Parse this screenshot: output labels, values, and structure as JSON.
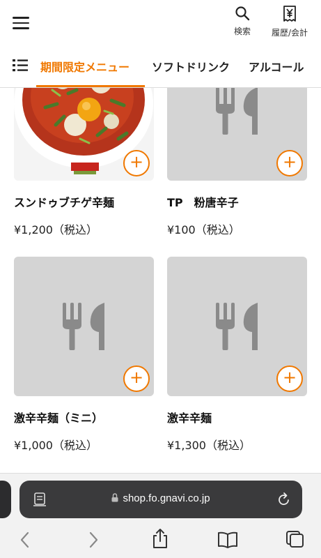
{
  "header": {
    "search_label": "検索",
    "history_label": "履歴/会計",
    "history_icon": "receipt-yen-icon"
  },
  "tabs": [
    {
      "label": "期間限定メニュー",
      "active": true
    },
    {
      "label": "ソフトドリンク",
      "active": false
    },
    {
      "label": "アルコール",
      "active": false
    }
  ],
  "menu_items": [
    {
      "name": "スンドゥブチゲ辛麺",
      "price": "¥1,200（税込）",
      "image": "photo"
    },
    {
      "name": "TP　粉唐辛子",
      "price": "¥100（税込）",
      "image": "placeholder"
    },
    {
      "name": "激辛辛麺（ミニ）",
      "price": "¥1,000（税込）",
      "image": "placeholder"
    },
    {
      "name": "激辛辛麺",
      "price": "¥1,300（税込）",
      "image": "placeholder"
    }
  ],
  "add_label": "+",
  "browser": {
    "url": "shop.fo.gnavi.co.jp"
  },
  "colors": {
    "accent": "#f07800",
    "placeholder_bg": "#d4d4d4",
    "url_bar": "#3a3a3c"
  }
}
